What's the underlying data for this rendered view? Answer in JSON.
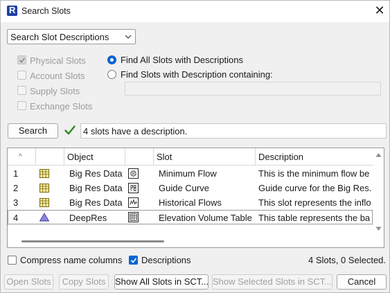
{
  "window": {
    "title": "Search Slots",
    "close_glyph": "✕"
  },
  "mode_select": {
    "value": "Search Slot Descriptions"
  },
  "categories": [
    {
      "label": "Physical Slots",
      "checked": true,
      "enabled": false
    },
    {
      "label": "Account Slots",
      "checked": false,
      "enabled": false
    },
    {
      "label": "Supply Slots",
      "checked": false,
      "enabled": false
    },
    {
      "label": "Exchange Slots",
      "checked": false,
      "enabled": false
    }
  ],
  "find_options": {
    "all_label": "Find All Slots with Descriptions",
    "containing_label": "Find Slots with Description containing:",
    "selected": "all",
    "containing_text": ""
  },
  "search": {
    "button_label": "Search",
    "status_text": "4 slots have a description."
  },
  "table": {
    "columns": [
      "",
      "",
      "Object",
      "",
      "Slot",
      "Description"
    ],
    "rows": [
      {
        "num": "1",
        "object_icon": "data-object-icon",
        "object": "Big Res Data",
        "slot_icon": "periodic-slot-icon",
        "slot": "Minimum Flow",
        "description": "This is the minimum flow be"
      },
      {
        "num": "2",
        "object_icon": "data-object-icon",
        "object": "Big Res Data",
        "slot_icon": "periodic-slot-icon",
        "slot": "Guide Curve",
        "description": "Guide curve for the Big Res."
      },
      {
        "num": "3",
        "object_icon": "data-object-icon",
        "object": "Big Res Data",
        "slot_icon": "series-slot-icon",
        "slot": "Historical Flows",
        "description": "This slot represents the inflo"
      },
      {
        "num": "4",
        "object_icon": "reservoir-icon",
        "object": "DeepRes",
        "slot_icon": "table-slot-icon",
        "slot": "Elevation Volume Table",
        "description": "This table represents the ba"
      }
    ],
    "selected_row": 4
  },
  "options": {
    "compress_label": "Compress name columns",
    "compress_checked": false,
    "descriptions_label": "Descriptions",
    "descriptions_checked": true,
    "summary": "4 Slots, 0 Selected."
  },
  "buttons": {
    "open": "Open Slots",
    "copy": "Copy Slots",
    "show_all": "Show All Slots in SCT...",
    "show_selected": "Show Selected Slots in SCT...",
    "cancel": "Cancel"
  },
  "colors": {
    "accent": "#0a64d2",
    "check_green": "#2d8a1f",
    "reservoir_fill": "#8a86e0"
  }
}
